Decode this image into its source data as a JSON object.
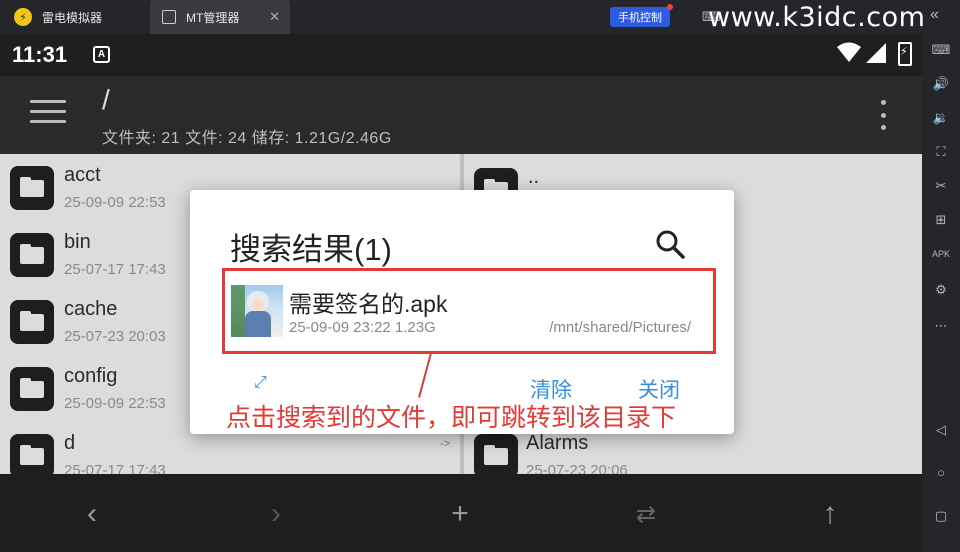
{
  "emulator": {
    "tabs": [
      {
        "label": "雷电模拟器"
      },
      {
        "label": "MT管理器"
      }
    ],
    "phone_control": "手机控制",
    "watermark": "www.k3idc.com"
  },
  "status": {
    "time": "11:31",
    "notif_icon": "A"
  },
  "toolbar": {
    "path": "/",
    "summary": "文件夹: 21  文件: 24  储存: 1.21G/2.46G"
  },
  "left_pane": [
    {
      "name": "acct",
      "date": "25-09-09 22:53"
    },
    {
      "name": "bin",
      "date": "25-07-17 17:43"
    },
    {
      "name": "cache",
      "date": "25-07-23 20:03"
    },
    {
      "name": "config",
      "date": "25-09-09 22:53"
    },
    {
      "name": "d",
      "date": "25-07-17 17:43"
    }
  ],
  "right_pane": [
    {
      "name": "..",
      "date": ""
    },
    {
      "name": "Alarms",
      "date": "25-07-23 20:06"
    }
  ],
  "link_arrow": "->",
  "dialog": {
    "title": "搜索结果(1)",
    "result": {
      "name": "需要签名的.apk",
      "meta": "25-09-09 23:22  1.23G",
      "path": "/mnt/shared/Pictures/"
    },
    "clear_label": "清除",
    "close_label": "关闭"
  },
  "annotation": "点击搜索到的文件，即可跳转到该目录下",
  "icons": {
    "accent": "#3b8fd9",
    "highlight": "#e53935"
  }
}
